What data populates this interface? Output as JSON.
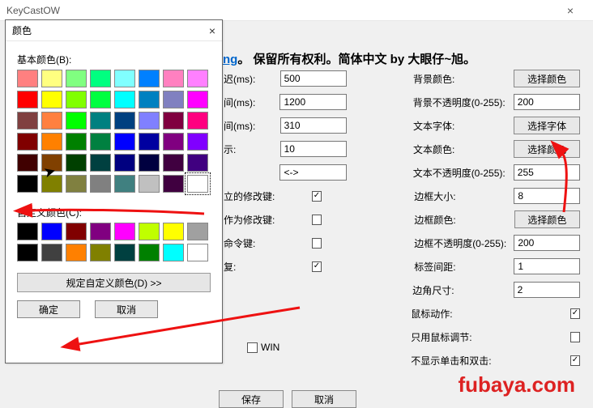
{
  "parent_window": {
    "title": "KeyCastOW"
  },
  "header": {
    "link_fragment": "ng",
    "text": "。  保留所有权利。简体中文 by 大眼仔~旭。"
  },
  "form": {
    "rows": [
      {
        "label_left": "迟(ms):",
        "value_left": "500",
        "label_right": "背景颜色:",
        "right_type": "button",
        "right": "选择颜色"
      },
      {
        "label_left": "间(ms):",
        "value_left": "1200",
        "label_right": "背景不透明度(0-255):",
        "right_type": "input",
        "right": "200"
      },
      {
        "label_left": "间(ms):",
        "value_left": "310",
        "label_right": "文本字体:",
        "right_type": "button",
        "right": "选择字体"
      },
      {
        "label_left": "示:",
        "value_left": "10",
        "label_right": "文本颜色:",
        "right_type": "button",
        "right": "选择颜色"
      },
      {
        "label_left": "",
        "value_left": "<->",
        "label_right": "文本不透明度(0-255):",
        "right_type": "input",
        "right": "255"
      },
      {
        "label_left": "立的修改键:",
        "left_type": "check",
        "left_checked": true,
        "label_right": "边框大小:",
        "right_type": "input",
        "right": "8"
      },
      {
        "label_left": "作为修改键:",
        "left_type": "check",
        "left_checked": false,
        "label_right": "边框颜色:",
        "right_type": "button",
        "right": "选择颜色"
      },
      {
        "label_left": "命令键:",
        "left_type": "check",
        "left_checked": false,
        "label_right": "边框不透明度(0-255):",
        "right_type": "input",
        "right": "200"
      },
      {
        "label_left": "复:",
        "left_type": "check",
        "left_checked": true,
        "label_right": "标签间距:",
        "right_type": "input",
        "right": "1"
      },
      {
        "label_left": "",
        "left_type": "none",
        "label_right": "边角尺寸:",
        "right_type": "input",
        "right": "2"
      },
      {
        "label_left": "",
        "left_type": "none",
        "label_right": "鼠标动作:",
        "right_type": "check",
        "right_checked": true
      },
      {
        "label_left": "",
        "left_type": "none",
        "label_right": "只用鼠标调节:",
        "right_type": "check",
        "right_checked": false
      },
      {
        "label_left": "",
        "left_type": "none",
        "label_right": "不显示单击和双击:",
        "right_type": "check",
        "right_checked": true
      }
    ],
    "win_checkbox_label": "WIN",
    "win_checked": false
  },
  "bottom_buttons": {
    "save": "保存",
    "cancel": "取消"
  },
  "color_dialog": {
    "title": "颜色",
    "basic_label": "基本颜色(B):",
    "custom_label": "自定义颜色(C):",
    "define_custom": "规定自定义颜色(D) >>",
    "ok": "确定",
    "cancel": "取消",
    "basic_colors": [
      "#ff8080",
      "#ffff80",
      "#80ff80",
      "#00ff80",
      "#80ffff",
      "#0080ff",
      "#ff80c0",
      "#ff80ff",
      "#ff0000",
      "#ffff00",
      "#80ff00",
      "#00ff40",
      "#00ffff",
      "#0080c0",
      "#8080c0",
      "#ff00ff",
      "#804040",
      "#ff8040",
      "#00ff00",
      "#008080",
      "#004080",
      "#8080ff",
      "#800040",
      "#ff0080",
      "#800000",
      "#ff8000",
      "#008000",
      "#008040",
      "#0000ff",
      "#0000a0",
      "#800080",
      "#8000ff",
      "#400000",
      "#804000",
      "#004000",
      "#004040",
      "#000080",
      "#000040",
      "#400040",
      "#400080",
      "#000000",
      "#808000",
      "#808040",
      "#808080",
      "#408080",
      "#c0c0c0",
      "#400040",
      "#ffffff"
    ],
    "custom_colors": [
      "#000000",
      "#0000ff",
      "#800000",
      "#800080",
      "#ff00ff",
      "#c0ff00",
      "#ffff00",
      "#a0a0a0",
      "#000000",
      "#404040",
      "#ff8000",
      "#808000",
      "#004040",
      "#008000",
      "#00ffff",
      "#ffffff"
    ]
  },
  "watermark": "fubaya.com"
}
